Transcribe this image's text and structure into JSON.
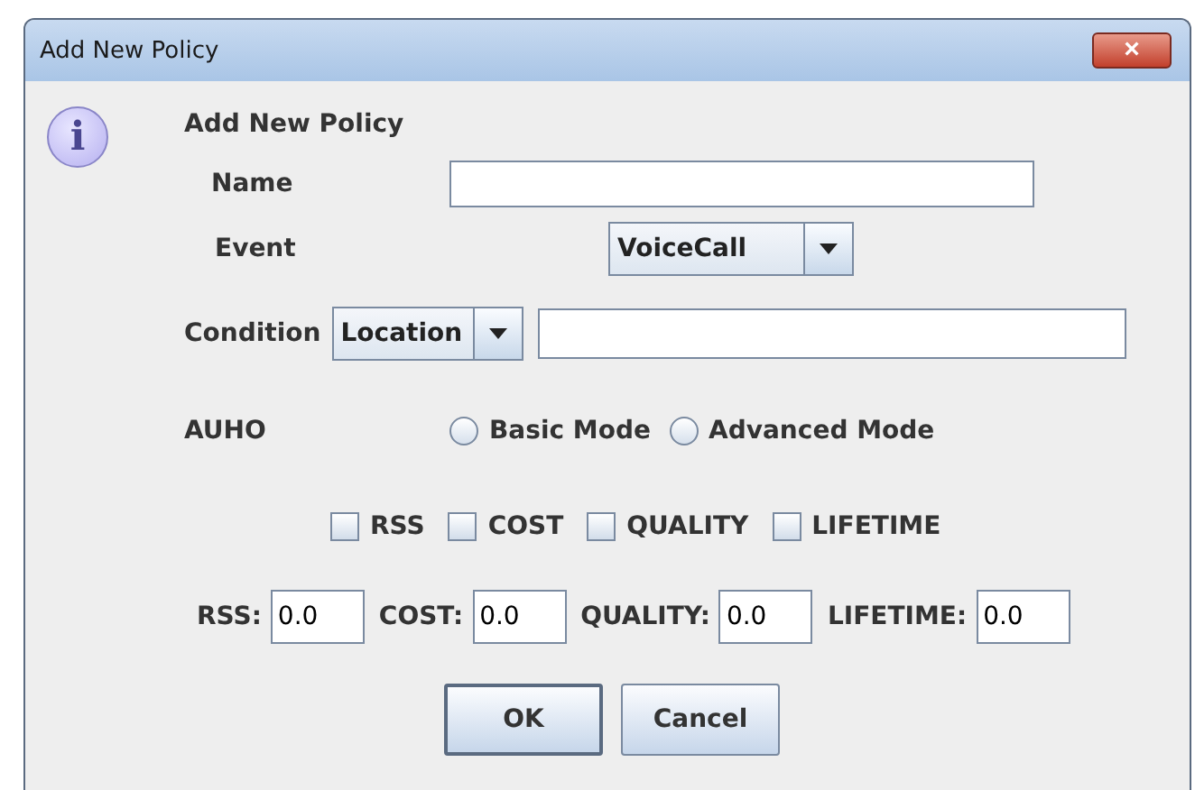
{
  "window": {
    "title": "Add New Policy",
    "close_label": "×"
  },
  "dialog": {
    "icon_glyph": "i",
    "heading": "Add New Policy",
    "name": {
      "label": "Name"
    },
    "event": {
      "label": "Event",
      "value": "VoiceCall"
    },
    "condition": {
      "label": "Condition",
      "value": "Location"
    },
    "auho": {
      "label": "AUHO",
      "options": [
        {
          "label": "Basic Mode",
          "selected": false
        },
        {
          "label": "Advanced Mode",
          "selected": false
        }
      ]
    },
    "criteria": [
      {
        "label": "RSS",
        "checked": false
      },
      {
        "label": "COST",
        "checked": false
      },
      {
        "label": "QUALITY",
        "checked": false
      },
      {
        "label": "LIFETIME",
        "checked": false
      }
    ],
    "weights": [
      {
        "label": "RSS:",
        "value": "0.0"
      },
      {
        "label": "COST:",
        "value": "0.0"
      },
      {
        "label": "QUALITY:",
        "value": "0.0"
      },
      {
        "label": "LIFETIME:",
        "value": "0.0"
      }
    ],
    "buttons": [
      {
        "label": "OK",
        "focused": true
      },
      {
        "label": "Cancel",
        "focused": false
      }
    ]
  }
}
